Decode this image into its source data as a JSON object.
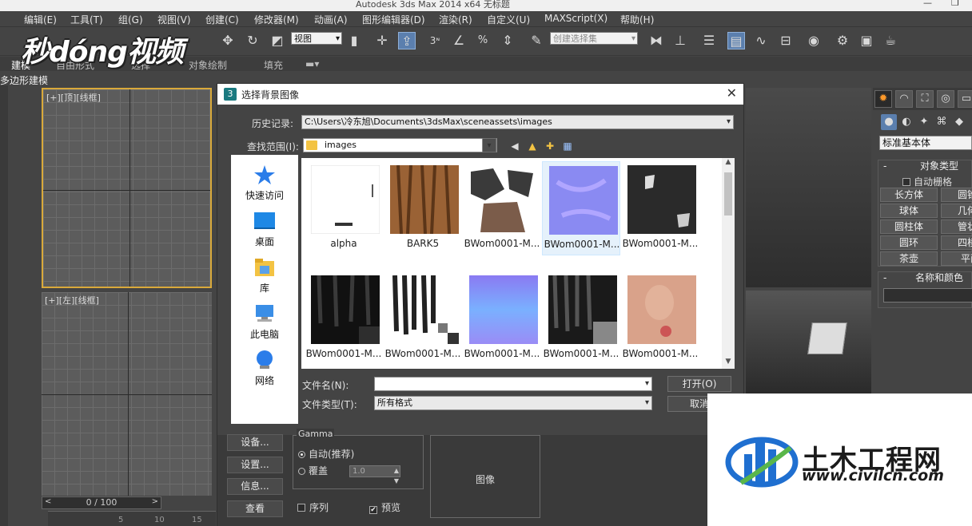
{
  "app": {
    "title": "Autodesk 3ds Max  2014 x64     无标题",
    "window_controls": [
      "—",
      "❐"
    ]
  },
  "menu": [
    "编辑(E)",
    "工具(T)",
    "组(G)",
    "视图(V)",
    "创建(C)",
    "修改器(M)",
    "动画(A)",
    "图形编辑器(D)",
    "渲染(R)",
    "自定义(U)",
    "MAXScript(X)",
    "帮助(H)"
  ],
  "toolbar": {
    "view_select": "视图",
    "selection_set": "创建选择集",
    "snap_3": "3",
    "icons": [
      "link-icon",
      "move-icon",
      "rotate-icon",
      "scale-icon",
      "snap-icon",
      "angle-snap-icon",
      "percent-snap-icon",
      "spinner-snap-icon",
      "mirror-icon",
      "align-icon",
      "layer-icon",
      "scene-explorer-icon",
      "curve-editor-icon",
      "schematic-icon",
      "material-editor-icon",
      "render-setup-icon",
      "render-frame-icon",
      "render-icon"
    ]
  },
  "ribbon": {
    "tabs": [
      "建模",
      "自由形式",
      "选择",
      "对象绘制",
      "填充"
    ],
    "sub": "多边形建模"
  },
  "viewports": {
    "top_label": "[+][顶][线框]",
    "front_label": "[+][左][线框]",
    "timeline": "0 / 100",
    "ruler_ticks": [
      "5",
      "10",
      "15"
    ]
  },
  "command_panel": {
    "dropdown": "标准基本体",
    "object_type_header": "对象类型",
    "autogrid": "自动栅格",
    "objects": [
      "长方体",
      "圆锥体",
      "球体",
      "几何球体",
      "圆柱体",
      "管状体",
      "圆环",
      "四棱锥",
      "茶壶",
      "平面"
    ],
    "name_color_header": "名称和颜色"
  },
  "dialog": {
    "title": "选择背景图像",
    "history_label": "历史记录:",
    "history_value": "C:\\Users\\冷东旭\\Documents\\3dsMax\\sceneassets\\images",
    "lookin_label": "查找范围(I):",
    "lookin_value": "images",
    "places": [
      "快速访问",
      "桌面",
      "库",
      "此电脑",
      "网络"
    ],
    "files": [
      "alpha",
      "BARK5",
      "BWom0001-M...",
      "BWom0001-M...",
      "BWom0001-M...",
      "BWom0001-M...",
      "BWom0001-M...",
      "BWom0001-M...",
      "BWom0001-M...",
      "BWom0001-M..."
    ],
    "filename_label": "文件名(N):",
    "filename_value": "",
    "filetype_label": "文件类型(T):",
    "filetype_value": "所有格式",
    "open_button": "打开(O)",
    "cancel_button": "取消",
    "setup_button": "设备...",
    "settings_button": "设置...",
    "info_button": "信息...",
    "view_button": "查看",
    "gamma_legend": "Gamma",
    "gamma_auto": "自动(推荐)",
    "gamma_override": "覆盖",
    "gamma_value": "1.0",
    "preview_label": "图像",
    "sequence_label": "序列",
    "preview_check_label": "预览"
  },
  "watermarks": {
    "top": "秒dóng视频",
    "bottom_cn": "土木工程网",
    "bottom_url": "www.civilcn.com"
  }
}
